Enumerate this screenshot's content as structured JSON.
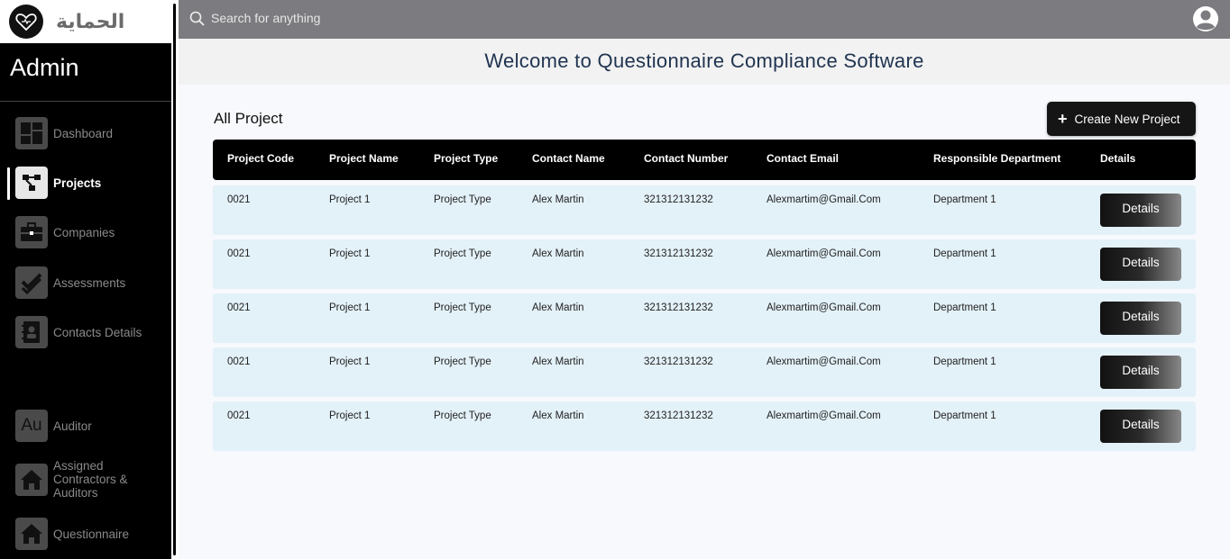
{
  "app": {
    "logo_text": "الحماية",
    "role_title": "Admin"
  },
  "sidebar": {
    "items": [
      {
        "label": "Dashboard",
        "icon": "dashboard-icon",
        "active": false
      },
      {
        "label": "Projects",
        "icon": "projects-icon",
        "active": true
      },
      {
        "label": "Companies",
        "icon": "briefcase-icon",
        "active": false
      },
      {
        "label": "Assessments",
        "icon": "check-icon",
        "active": false
      },
      {
        "label": "Contacts Details",
        "icon": "contacts-icon",
        "active": false
      },
      {
        "label": "Auditor",
        "icon": "au-icon",
        "active": false
      },
      {
        "label": "Assigned Contractors & Auditors",
        "icon": "home-icon",
        "active": false
      },
      {
        "label": "Questionnaire",
        "icon": "home-icon",
        "active": false
      }
    ],
    "auditor_icon_text": "Au"
  },
  "topbar": {
    "search_placeholder": "Search for anything"
  },
  "welcome": "Welcome to Questionnaire Compliance Software",
  "main": {
    "heading": "All Project",
    "create_button": "Create New Project",
    "columns": [
      "Project Code",
      "Project Name",
      "Project Type",
      "Contact Name",
      "Contact Number",
      "Contact Email",
      "Responsible Department",
      "Details"
    ],
    "rows": [
      {
        "code": "0021",
        "name": "Project 1",
        "type": "Project Type",
        "contact": "Alex Martin",
        "number": "321312131232",
        "email": "Alexmartim@Gmail.Com",
        "department": "Department 1",
        "action": "Details"
      },
      {
        "code": "0021",
        "name": "Project 1",
        "type": "Project Type",
        "contact": "Alex Martin",
        "number": "321312131232",
        "email": "Alexmartim@Gmail.Com",
        "department": "Department 1",
        "action": "Details"
      },
      {
        "code": "0021",
        "name": "Project 1",
        "type": "Project Type",
        "contact": "Alex Martin",
        "number": "321312131232",
        "email": "Alexmartim@Gmail.Com",
        "department": "Department 1",
        "action": "Details"
      },
      {
        "code": "0021",
        "name": "Project 1",
        "type": "Project Type",
        "contact": "Alex Martin",
        "number": "321312131232",
        "email": "Alexmartim@Gmail.Com",
        "department": "Department 1",
        "action": "Details"
      },
      {
        "code": "0021",
        "name": "Project 1",
        "type": "Project Type",
        "contact": "Alex Martin",
        "number": "321312131232",
        "email": "Alexmartim@Gmail.Com",
        "department": "Department 1",
        "action": "Details"
      }
    ]
  },
  "colors": {
    "sidebar_bg": "#000000",
    "topbar_bg": "#7c7c80",
    "row_bg": "#e3f1f8",
    "welcome_text": "#1f3450"
  }
}
